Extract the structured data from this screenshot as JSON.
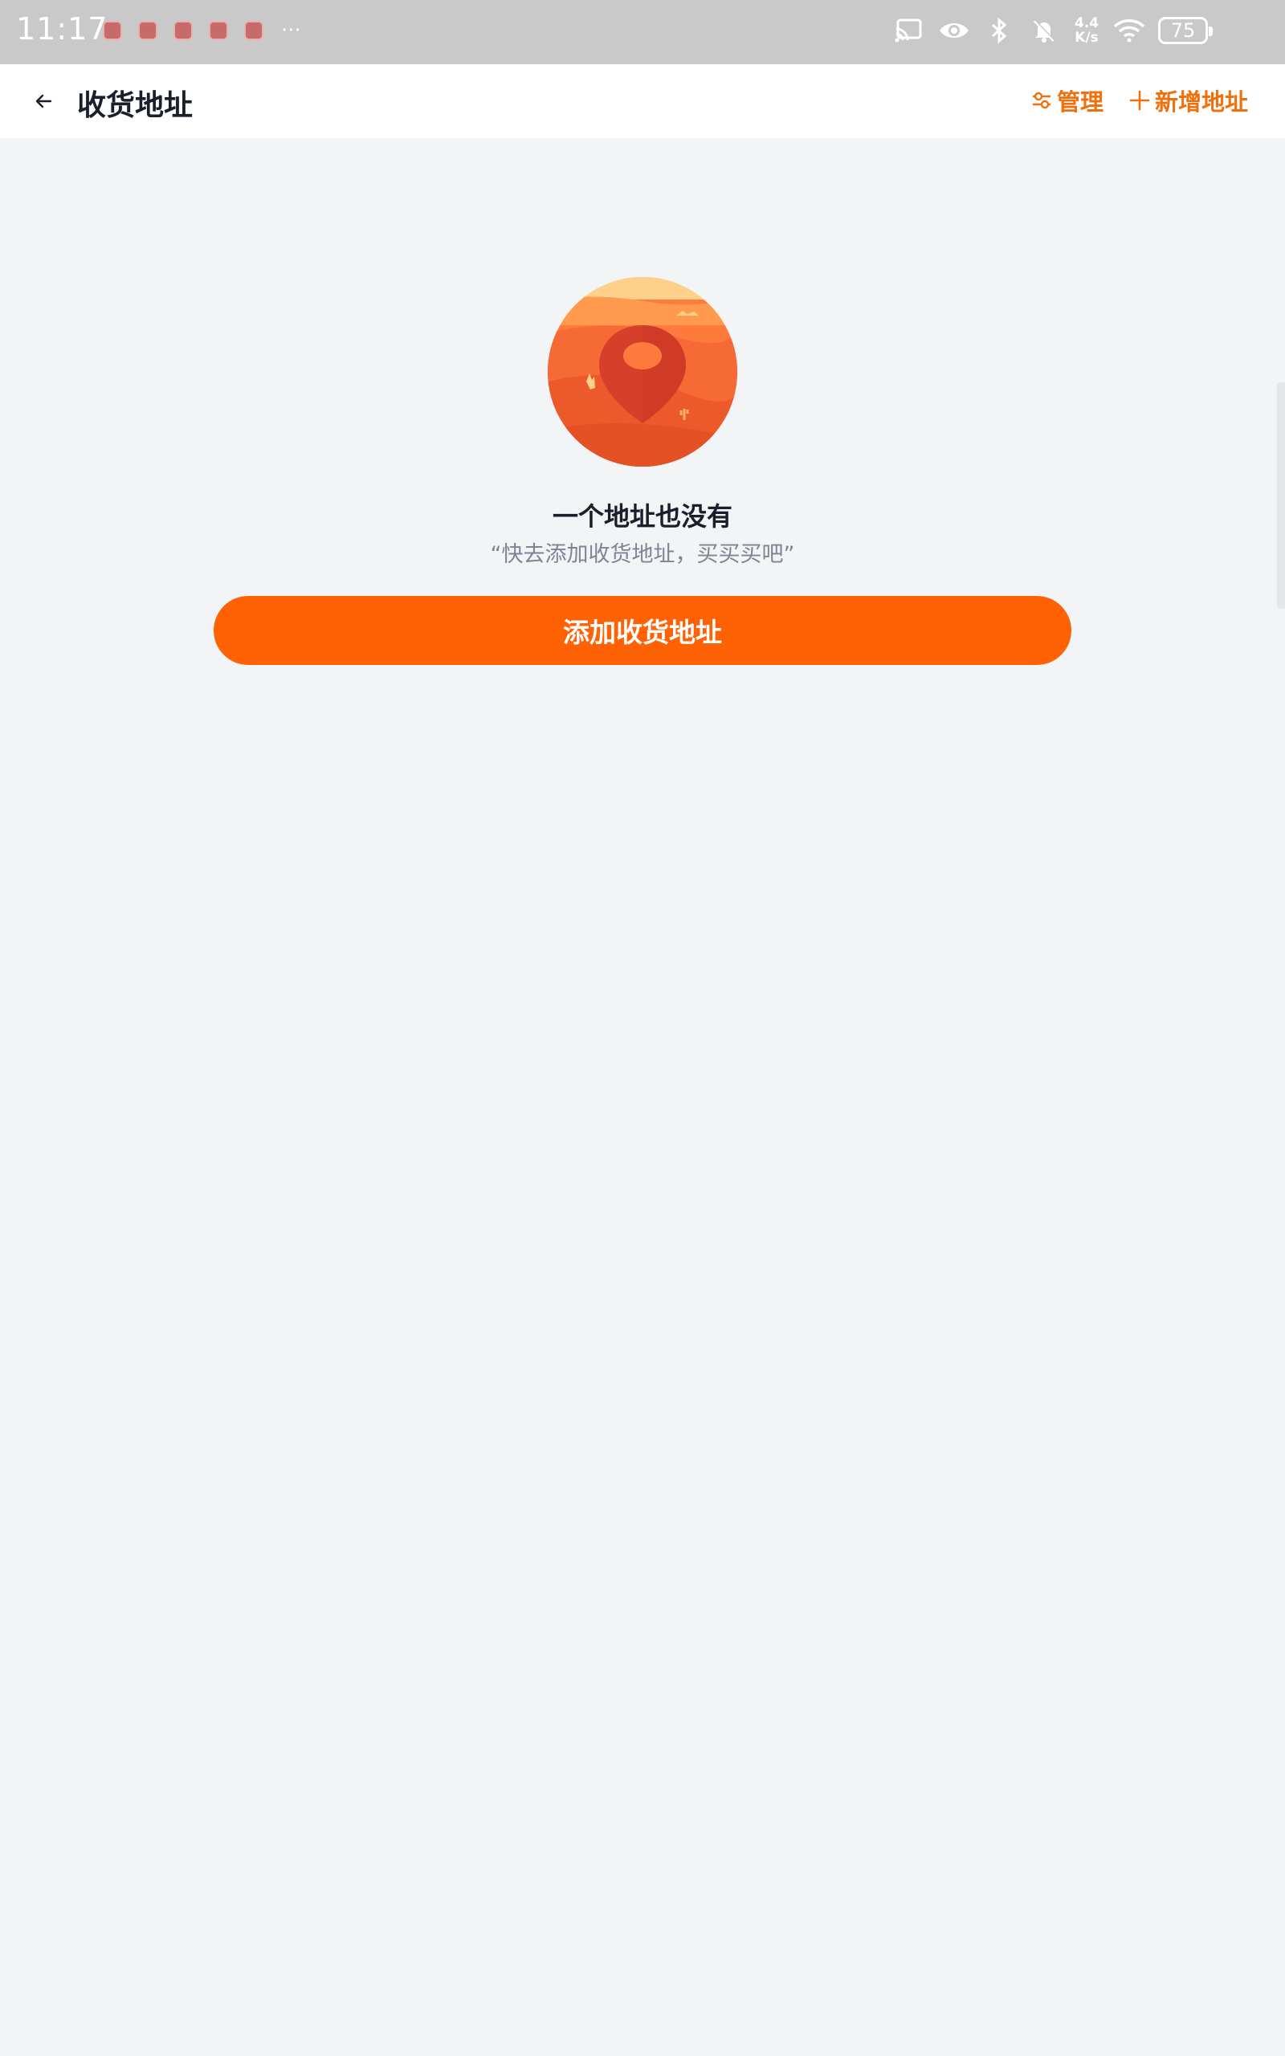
{
  "status_bar": {
    "time": "11:17",
    "more": "···",
    "net_speed_value": "4.4",
    "net_speed_unit": "K/s",
    "battery": "75",
    "icons": [
      "cast-icon",
      "eye-icon",
      "bluetooth-icon",
      "bell-off-icon",
      "wifi-icon",
      "battery-icon"
    ]
  },
  "header": {
    "title": "收货地址",
    "manage_label": "管理",
    "add_label": "新增地址"
  },
  "empty_state": {
    "title": "一个地址也没有",
    "subtitle": "“快去添加收货地址，买买买吧”",
    "button_label": "添加收货地址"
  },
  "colors": {
    "accent": "#ff6205",
    "header_action": "#f0700d",
    "background": "#f3f4f6",
    "status_bar": "#c9c9c9"
  }
}
